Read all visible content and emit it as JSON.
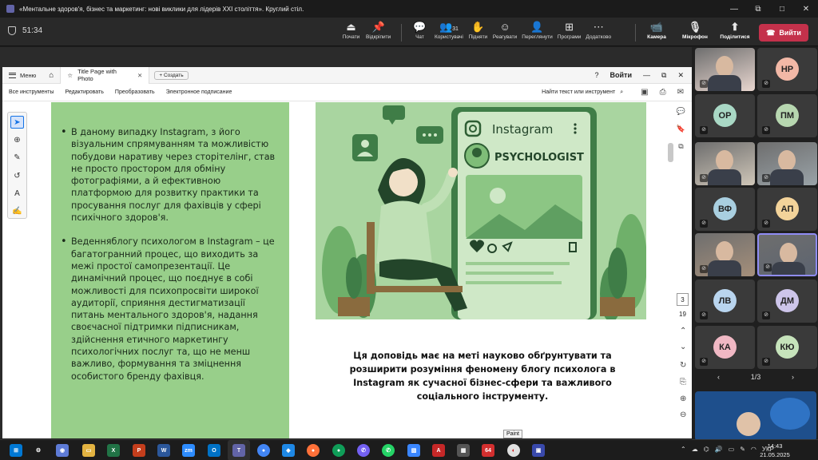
{
  "window": {
    "title": "«Ментальне здоров'я, бізнес та маркетинг: нові виклики для лідерів XXI століття». Круглий стіл.",
    "controls": [
      "—",
      "⧉",
      "□",
      "✕"
    ]
  },
  "meeting": {
    "timer": "51:34",
    "toolbar_left": [
      {
        "icon": "stop-sharing-icon",
        "glyph": "⏏",
        "label": "Почати"
      },
      {
        "icon": "unpin-icon",
        "glyph": "📌",
        "label": "Відкріпити"
      }
    ],
    "toolbar_main": [
      {
        "icon": "chat-icon",
        "glyph": "💬",
        "label": "Чат",
        "count": ""
      },
      {
        "icon": "people-icon",
        "glyph": "👥",
        "label": "Користувачі",
        "count": "31"
      },
      {
        "icon": "raise-hand-icon",
        "glyph": "✋",
        "label": "Підняти",
        "count": ""
      },
      {
        "icon": "react-icon",
        "glyph": "☺",
        "label": "Реагувати",
        "count": ""
      },
      {
        "icon": "view-icon",
        "glyph": "👤",
        "label": "Переглянути",
        "count": ""
      },
      {
        "icon": "apps-icon",
        "glyph": "⊞",
        "label": "Програми",
        "count": ""
      },
      {
        "icon": "more-icon",
        "glyph": "⋯",
        "label": "Додатково",
        "count": ""
      }
    ],
    "toolbar_av": [
      {
        "icon": "camera-icon",
        "glyph": "📹",
        "label": "Камера"
      },
      {
        "icon": "mic-off-icon",
        "glyph": "🎙",
        "label": "Мікрофон"
      },
      {
        "icon": "share-icon",
        "glyph": "⬆",
        "label": "Поділитися"
      }
    ],
    "leave_label": "Вийти"
  },
  "acrobat": {
    "menu_label": "Меню",
    "tab_label": "Title Page with Photo",
    "new_tab_label": "Создать",
    "sign_in_label": "Войти",
    "tools": [
      "Все инструменты",
      "Редактировать",
      "Преобразовать",
      "Электронное подписание"
    ],
    "search_label": "Найти текст или инструмент",
    "page_current": "3",
    "page_total": "19"
  },
  "slide": {
    "bullets": [
      "В даному випадку Instagram, з його візуальним спрямуванням та можливістю побудови наративу через сторітелінг, став не просто простором для обміну фотографіями, а й ефективною платформою для розвитку практики та просування послуг для фахівців у сфері психічного здоров'я.",
      "Веденняблогу психологом в Instagram – це багатогранний процес, що виходить за межі простої самопрезентації. Це динамічний процес, що поєднує в собі можливості для психопросвіти широкої аудиторії, сприяння дестигматизації питань ментального здоров'я, надання своєчасної підтримки підписникам, здійснення етичного маркетингу психологічних послуг та, що не менш важливо, формування та зміцнення особистого бренду фахівця."
    ],
    "illustration": {
      "app_name": "Instagram",
      "profile_name": "PSYCHOLOGIST"
    },
    "summary": "Ця доповідь має на меті науково обґрунтувати та розширити розуміння феномену блогу психолога в Instagram як сучасної бізнес-сфери та важливого соціального інструменту."
  },
  "participants": [
    {
      "initials": "",
      "color": "#e8d6cf",
      "video": true
    },
    {
      "initials": "НР",
      "color": "#f2b8a6",
      "video": false
    },
    {
      "initials": "ОР",
      "color": "#a9d8c5",
      "video": false
    },
    {
      "initials": "ПМ",
      "color": "#b7d7b0",
      "video": false
    },
    {
      "initials": "",
      "color": "#cfc6b8",
      "video": true
    },
    {
      "initials": "",
      "color": "#9aa3a8",
      "video": true
    },
    {
      "initials": "ВФ",
      "color": "#a9cfe0",
      "video": false
    },
    {
      "initials": "АП",
      "color": "#f3d39a",
      "video": false
    },
    {
      "initials": "",
      "color": "#a58f7a",
      "video": true
    },
    {
      "initials": "",
      "color": "#5d6470",
      "video": true
    },
    {
      "initials": "ЛВ",
      "color": "#b9d5ef",
      "video": false
    },
    {
      "initials": "ДМ",
      "color": "#cdc5ea",
      "video": false
    },
    {
      "initials": "КА",
      "color": "#f0b8c4",
      "video": false
    },
    {
      "initials": "КЮ",
      "color": "#c6e3bb",
      "video": false
    }
  ],
  "participants_pager": "1/3",
  "taskbar": {
    "tooltip": "Paint",
    "language": "УКР",
    "time": "14:43",
    "date": "21.05.2025"
  }
}
